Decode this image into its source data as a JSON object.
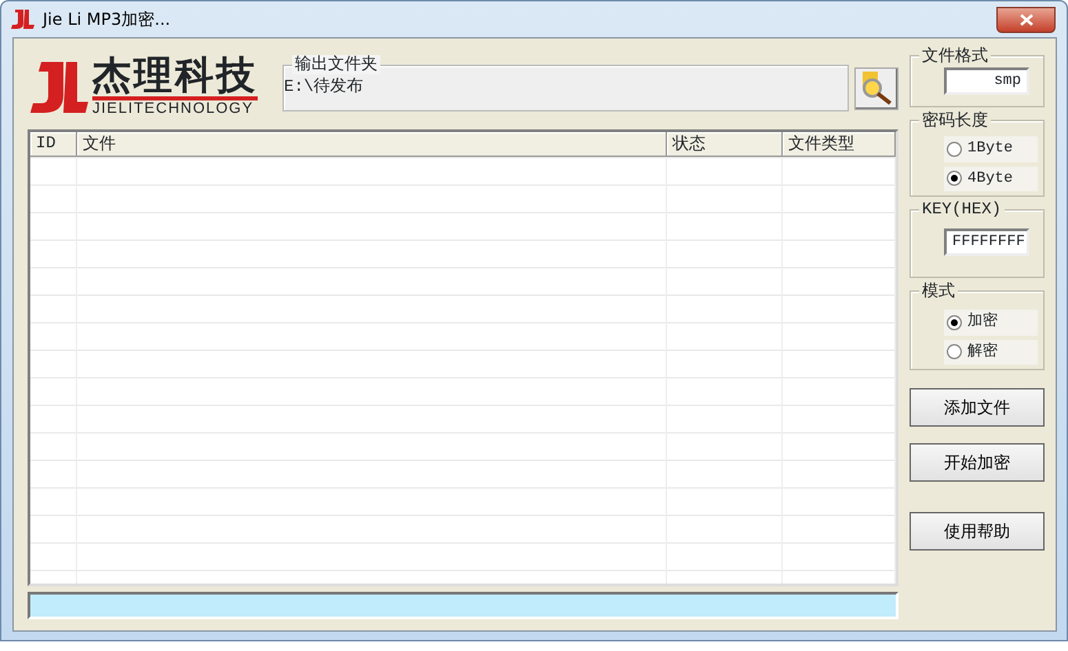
{
  "window": {
    "title": "Jie Li MP3加密..."
  },
  "logo": {
    "name": "杰理科技",
    "subtitle": "JIELITECHNOLOGY"
  },
  "output_folder": {
    "label": "输出文件夹",
    "value": "E:\\待发布"
  },
  "table": {
    "columns": [
      "ID",
      "文件",
      "状态",
      "文件类型"
    ]
  },
  "file_format": {
    "label": "文件格式",
    "value": "smp"
  },
  "password_length": {
    "label": "密码长度",
    "options": [
      {
        "label": "1Byte",
        "selected": false
      },
      {
        "label": "4Byte",
        "selected": true
      }
    ]
  },
  "key": {
    "label": "KEY(HEX)",
    "value": "FFFFFFFF"
  },
  "mode": {
    "label": "模式",
    "options": [
      {
        "label": "加密",
        "selected": true
      },
      {
        "label": "解密",
        "selected": false
      }
    ]
  },
  "buttons": [
    "添加文件",
    "开始加密",
    "使用帮助"
  ],
  "progress": {
    "level": 0
  }
}
